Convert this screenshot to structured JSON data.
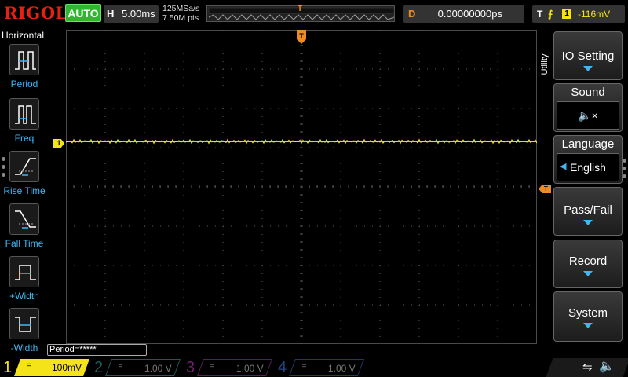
{
  "top": {
    "brand": "RIGOL",
    "run_state": "AUTO",
    "timebase_label": "H",
    "timebase_value": "5.00ms",
    "sample_rate": "125MSa/s",
    "memory_depth": "7.50M pts",
    "delay_label": "D",
    "delay_value": "0.00000000ps",
    "trigger_label": "T",
    "trigger_source": "1",
    "trigger_level": "-116mV",
    "trigger_position_marker": "T"
  },
  "left_panel": {
    "title": "Horizontal",
    "items": [
      {
        "label": "Period",
        "icon": "period-icon"
      },
      {
        "label": "Freq",
        "icon": "frequency-icon"
      },
      {
        "label": "Rise Time",
        "icon": "rise-time-icon"
      },
      {
        "label": "Fall Time",
        "icon": "fall-time-icon"
      },
      {
        "label": "+Width",
        "icon": "positive-width-icon"
      },
      {
        "label": "-Width",
        "icon": "negative-width-icon"
      }
    ]
  },
  "waveform": {
    "channel_marker": "1",
    "trigger_level_marker": "T",
    "trace_color": "#f5e31a",
    "measurement": "Period=*****"
  },
  "right_menu": {
    "tab_label": "Utility",
    "items": [
      {
        "label": "IO Setting",
        "icon": "submenu-arrow-icon"
      },
      {
        "label": "Sound",
        "value_icon": "speaker-muted-icon",
        "value": "🔈×"
      },
      {
        "label": "Language",
        "value": "English"
      },
      {
        "label": "Pass/Fail",
        "icon": "submenu-arrow-icon"
      },
      {
        "label": "Record",
        "icon": "submenu-arrow-icon"
      },
      {
        "label": "System",
        "icon": "submenu-arrow-icon"
      }
    ]
  },
  "channels": [
    {
      "num": "1",
      "scale": "100mV",
      "coupling": "=",
      "color": "#f5e31a",
      "active": true
    },
    {
      "num": "2",
      "scale": "1.00 V",
      "coupling": "=",
      "color": "#1f7773",
      "active": false
    },
    {
      "num": "3",
      "scale": "1.00 V",
      "coupling": "=",
      "color": "#8a2b8a",
      "active": false
    },
    {
      "num": "4",
      "scale": "1.00 V",
      "coupling": "=",
      "color": "#2b56a3",
      "active": false
    }
  ],
  "status_icons": [
    "usb-icon",
    "speaker-muted-icon"
  ]
}
